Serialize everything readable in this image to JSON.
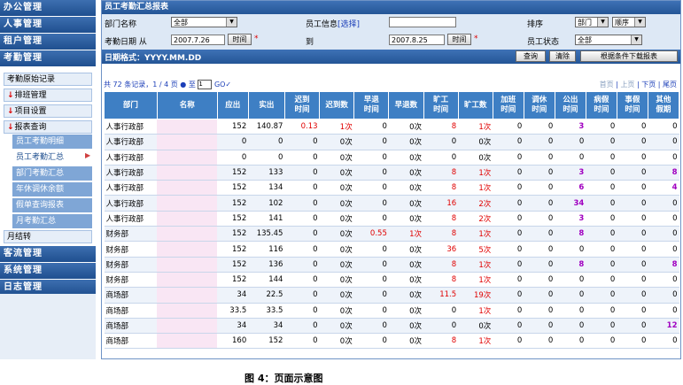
{
  "sidebar": {
    "headers_top": [
      "办公管理",
      "人事管理",
      "租户管理",
      "考勤管理"
    ],
    "sub1": [
      {
        "label": "考勤原始记录",
        "arrow": false
      },
      {
        "label": "排班管理",
        "arrow": true
      },
      {
        "label": "项目设置",
        "arrow": true
      },
      {
        "label": "报表查询",
        "arrow": true
      }
    ],
    "sub2": [
      {
        "label": "员工考勤明细",
        "active": false
      },
      {
        "label": "员工考勤汇总",
        "active": true
      },
      {
        "label": "部门考勤汇总",
        "active": false
      },
      {
        "label": "年休调休余额",
        "active": false
      },
      {
        "label": "假单查询报表",
        "active": false
      },
      {
        "label": "月考勤汇总",
        "active": false
      }
    ],
    "month_close": "月结转",
    "headers_bottom": [
      "客流管理",
      "系统管理",
      "日志管理"
    ],
    "active_marker": "▶"
  },
  "main": {
    "title": "员工考勤汇总报表",
    "dept_label": "部门名称",
    "dept_value": "全部",
    "emp_label": "员工信息",
    "select_link": "[选择]",
    "sort_label": "排序",
    "sort_value": "部门",
    "order_value": "顺序",
    "date_from_label": "考勤日期 从",
    "date_from": "2007.7.26",
    "time_btn": "时间",
    "to_label": "到",
    "date_to": "2007.8.25",
    "status_label": "员工状态",
    "status_value": "全部",
    "required_mark": "*",
    "format_text": "日期格式：YYYY.MM.DD",
    "query_btn": "查询",
    "clear_btn": "清除",
    "download_btn": "根据条件下载报表",
    "pager_left": "共 72 条记录，1 / 4 页  ● 至",
    "pager_page": "1",
    "pager_go": "GO✓",
    "pager_right": {
      "first": "首页",
      "prev": "上页",
      "next": "下页",
      "last": "尾页"
    }
  },
  "table": {
    "headers": [
      "部门",
      "名称",
      "应出",
      "实出",
      "迟到\n时间",
      "迟到数",
      "早退\n时间",
      "早退数",
      "旷工\n时间",
      "旷工数",
      "加班\n时间",
      "调休\n时间",
      "公出\n时间",
      "病假\n时间",
      "事假\n时间",
      "其他\n假期"
    ],
    "rows": [
      [
        "人事行政部",
        "",
        "152",
        "140.87",
        "0.13",
        "1次",
        "0",
        "0次",
        "8",
        "1次",
        "0",
        "0",
        "3",
        "0",
        "0",
        "0"
      ],
      [
        "人事行政部",
        "",
        "0",
        "0",
        "0",
        "0次",
        "0",
        "0次",
        "0",
        "0次",
        "0",
        "0",
        "0",
        "0",
        "0",
        "0"
      ],
      [
        "人事行政部",
        "",
        "0",
        "0",
        "0",
        "0次",
        "0",
        "0次",
        "0",
        "0次",
        "0",
        "0",
        "0",
        "0",
        "0",
        "0"
      ],
      [
        "人事行政部",
        "",
        "152",
        "133",
        "0",
        "0次",
        "0",
        "0次",
        "8",
        "1次",
        "0",
        "0",
        "3",
        "0",
        "0",
        "8"
      ],
      [
        "人事行政部",
        "",
        "152",
        "134",
        "0",
        "0次",
        "0",
        "0次",
        "8",
        "1次",
        "0",
        "0",
        "6",
        "0",
        "0",
        "4"
      ],
      [
        "人事行政部",
        "",
        "152",
        "102",
        "0",
        "0次",
        "0",
        "0次",
        "16",
        "2次",
        "0",
        "0",
        "34",
        "0",
        "0",
        "0"
      ],
      [
        "人事行政部",
        "",
        "152",
        "141",
        "0",
        "0次",
        "0",
        "0次",
        "8",
        "2次",
        "0",
        "0",
        "3",
        "0",
        "0",
        "0"
      ],
      [
        "财务部",
        "",
        "152",
        "135.45",
        "0",
        "0次",
        "0.55",
        "1次",
        "8",
        "1次",
        "0",
        "0",
        "8",
        "0",
        "0",
        "0"
      ],
      [
        "财务部",
        "",
        "152",
        "116",
        "0",
        "0次",
        "0",
        "0次",
        "36",
        "5次",
        "0",
        "0",
        "0",
        "0",
        "0",
        "0"
      ],
      [
        "财务部",
        "",
        "152",
        "136",
        "0",
        "0次",
        "0",
        "0次",
        "8",
        "1次",
        "0",
        "0",
        "8",
        "0",
        "0",
        "8"
      ],
      [
        "财务部",
        "",
        "152",
        "144",
        "0",
        "0次",
        "0",
        "0次",
        "8",
        "1次",
        "0",
        "0",
        "0",
        "0",
        "0",
        "0"
      ],
      [
        "商场部",
        "",
        "34",
        "22.5",
        "0",
        "0次",
        "0",
        "0次",
        "11.5",
        "19次",
        "0",
        "0",
        "0",
        "0",
        "0",
        "0"
      ],
      [
        "商场部",
        "",
        "33.5",
        "33.5",
        "0",
        "0次",
        "0",
        "0次",
        "0",
        "1次",
        "0",
        "0",
        "0",
        "0",
        "0",
        "0"
      ],
      [
        "商场部",
        "",
        "34",
        "34",
        "0",
        "0次",
        "0",
        "0次",
        "0",
        "0次",
        "0",
        "0",
        "0",
        "0",
        "0",
        "12"
      ],
      [
        "商场部",
        "",
        "160",
        "152",
        "0",
        "0次",
        "0",
        "0次",
        "8",
        "1次",
        "0",
        "0",
        "0",
        "0",
        "0",
        "0"
      ]
    ]
  },
  "caption": "图 4：页面示意图"
}
